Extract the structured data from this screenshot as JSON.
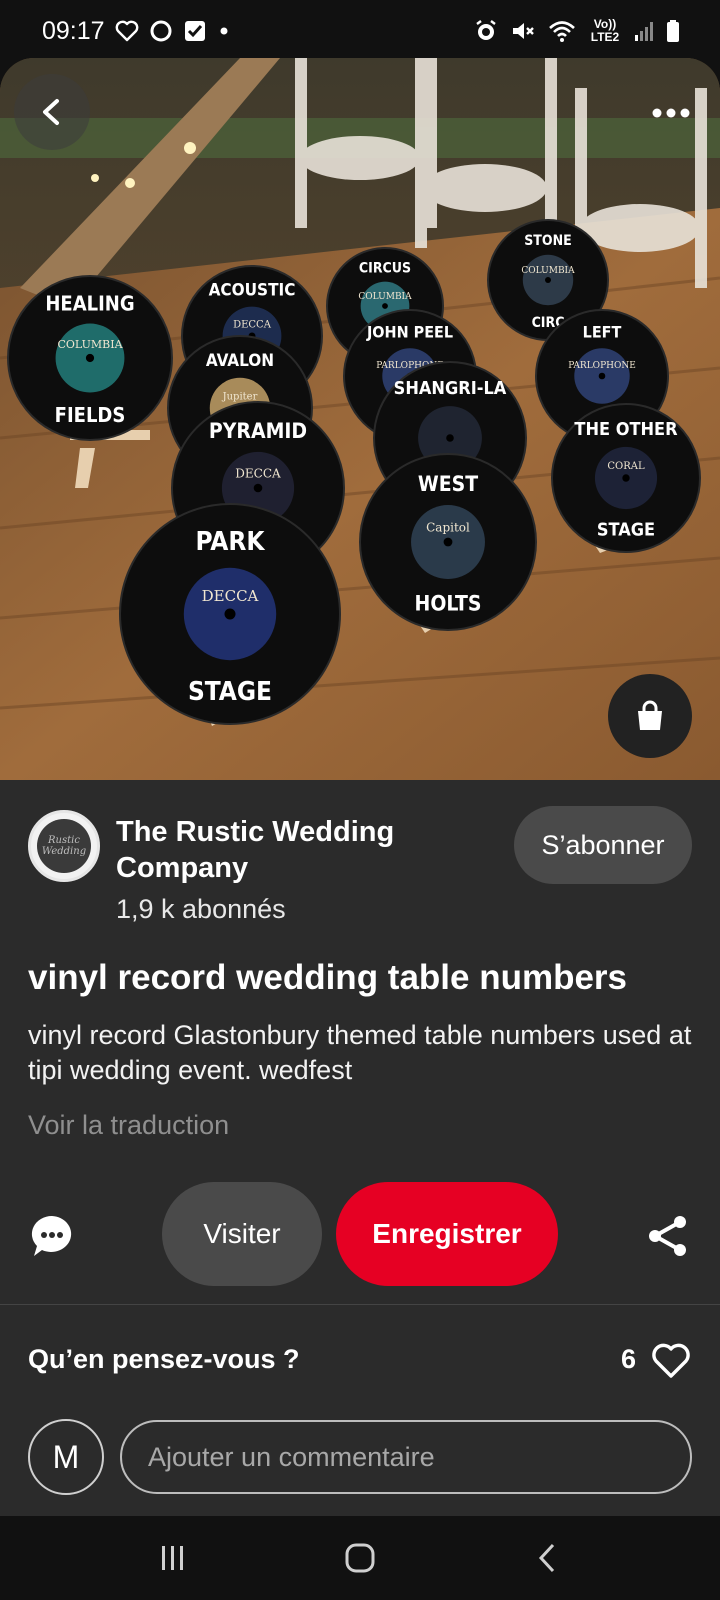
{
  "status_bar": {
    "time": "09:17",
    "network_label": "Vo)) LTE2",
    "left_icons": [
      "heart-outline-icon",
      "circle-icon",
      "checkbox-icon",
      "dot-icon"
    ],
    "right_icons": [
      "alarm-icon",
      "mute-icon",
      "wifi-icon",
      "signal-icon",
      "battery-icon"
    ]
  },
  "pin_image": {
    "alt": "Vinyl records used as wedding table numbers on wooden easels",
    "record_labels": [
      {
        "top": "HEALING",
        "bottom": "FIELDS",
        "brand": "COLUMBIA"
      },
      {
        "top": "ACOUSTIC",
        "bottom": "",
        "brand": "DECCA"
      },
      {
        "top": "CIRCUS",
        "bottom": "",
        "brand": "COLUMBIA"
      },
      {
        "top": "STONE",
        "bottom": "CIRC",
        "brand": "COLUMBIA"
      },
      {
        "top": "AVALON",
        "bottom": "",
        "brand": "Jupiter"
      },
      {
        "top": "JOHN PEEL",
        "bottom": "",
        "brand": "PARLOPHONE"
      },
      {
        "top": "LEFT",
        "bottom": "",
        "brand": "PARLOPHONE"
      },
      {
        "top": "PYRAMID",
        "bottom": "",
        "brand": "DECCA"
      },
      {
        "top": "SHANGRI-LA",
        "bottom": "",
        "brand": ""
      },
      {
        "top": "THE OTHER",
        "bottom": "STAGE",
        "brand": "CORAL"
      },
      {
        "top": "WEST",
        "bottom": "HOLTS",
        "brand": "Capitol"
      },
      {
        "top": "PARK",
        "bottom": "STAGE",
        "brand": "DECCA"
      }
    ],
    "icons": {
      "back": "chevron-left-icon",
      "more": "more-dots-icon",
      "shop": "shopping-bag-icon"
    }
  },
  "creator": {
    "name": "The Rustic Wedding Company",
    "followers": "1,9 k abonnés",
    "subscribe_label": "S’abonner",
    "avatar_text": "Rustic Wedding"
  },
  "pin": {
    "title": "vinyl record wedding table numbers",
    "description": "vinyl record Glastonbury themed table numbers used at tipi wedding event. wedfest",
    "translate_label": "Voir la traduction"
  },
  "actions": {
    "visit_label": "Visiter",
    "save_label": "Enregistrer",
    "comment_icon": "comment-bubble-icon",
    "share_icon": "share-icon",
    "save_color": "#e60023"
  },
  "comments": {
    "title": "Qu’en pensez-vous ?",
    "like_count": "6",
    "user_initial": "M",
    "input_placeholder": "Ajouter un commentaire"
  },
  "nav_bar": {
    "icons": [
      "recent-apps-icon",
      "home-icon",
      "back-icon"
    ]
  }
}
